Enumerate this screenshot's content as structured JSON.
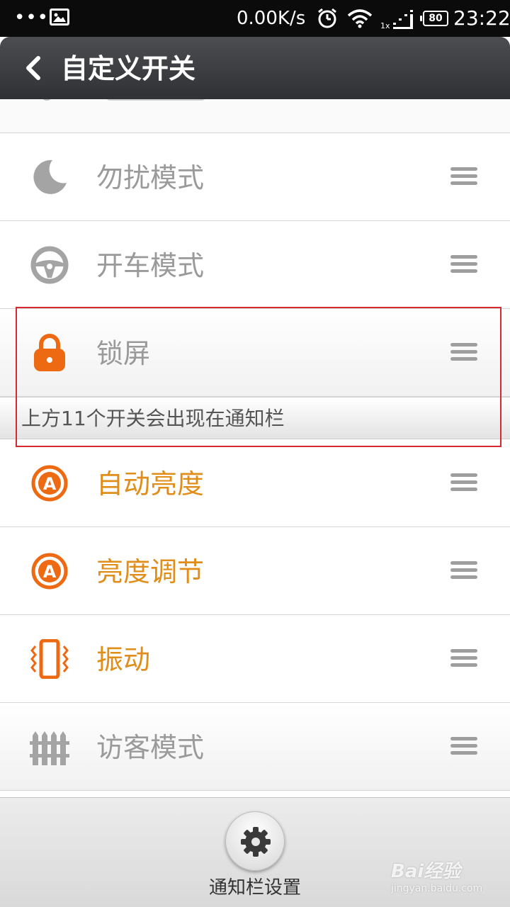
{
  "status_bar": {
    "dots": "•••",
    "network_speed": "0.00K/s",
    "battery": "80",
    "time": "23:22"
  },
  "title_bar": {
    "title": "自定义开关"
  },
  "toggles": [
    {
      "label": "勿扰模式",
      "icon": "moon-icon",
      "active": false
    },
    {
      "label": "开车模式",
      "icon": "steering-wheel-icon",
      "active": false
    },
    {
      "label": "锁屏",
      "icon": "lock-icon",
      "active": true
    },
    {
      "label": "自动亮度",
      "icon": "auto-brightness-icon",
      "active": true
    },
    {
      "label": "亮度调节",
      "icon": "brightness-icon",
      "active": true
    },
    {
      "label": "振动",
      "icon": "vibrate-icon",
      "active": true
    },
    {
      "label": "访客模式",
      "icon": "fence-icon",
      "active": false
    }
  ],
  "divider": {
    "text": "上方11个开关会出现在通知栏"
  },
  "bottom": {
    "settings_label": "通知栏设置"
  },
  "watermark": {
    "logo": "Bai经验",
    "url": "jingyan.baidu.com"
  },
  "colors": {
    "accent_orange": "#e08d19",
    "inactive_gray": "#9a9a9a",
    "highlight_red": "#d42a30"
  }
}
